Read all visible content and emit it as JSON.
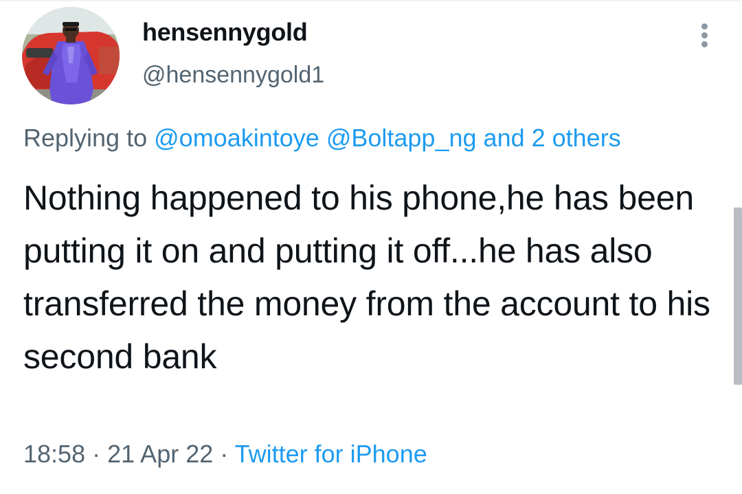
{
  "user": {
    "display_name": "hensennygold",
    "handle": "@hensennygold1"
  },
  "reply": {
    "prefix": "Replying to",
    "mention_1": "@omoakintoye",
    "mention_2": "@Boltapp_ng",
    "others": "and 2 others"
  },
  "tweet": {
    "text": "Nothing happened to his phone,he has been putting it on and putting it off...he has also transferred the money from the account to his second bank"
  },
  "meta": {
    "time": "18:58",
    "separator": "·",
    "date": "21 Apr 22",
    "source": "Twitter for iPhone"
  },
  "icons": {
    "more": "more-vertical-icon"
  },
  "colors": {
    "text_primary": "#0f1419",
    "text_secondary": "#536471",
    "link": "#1d9bf0"
  }
}
